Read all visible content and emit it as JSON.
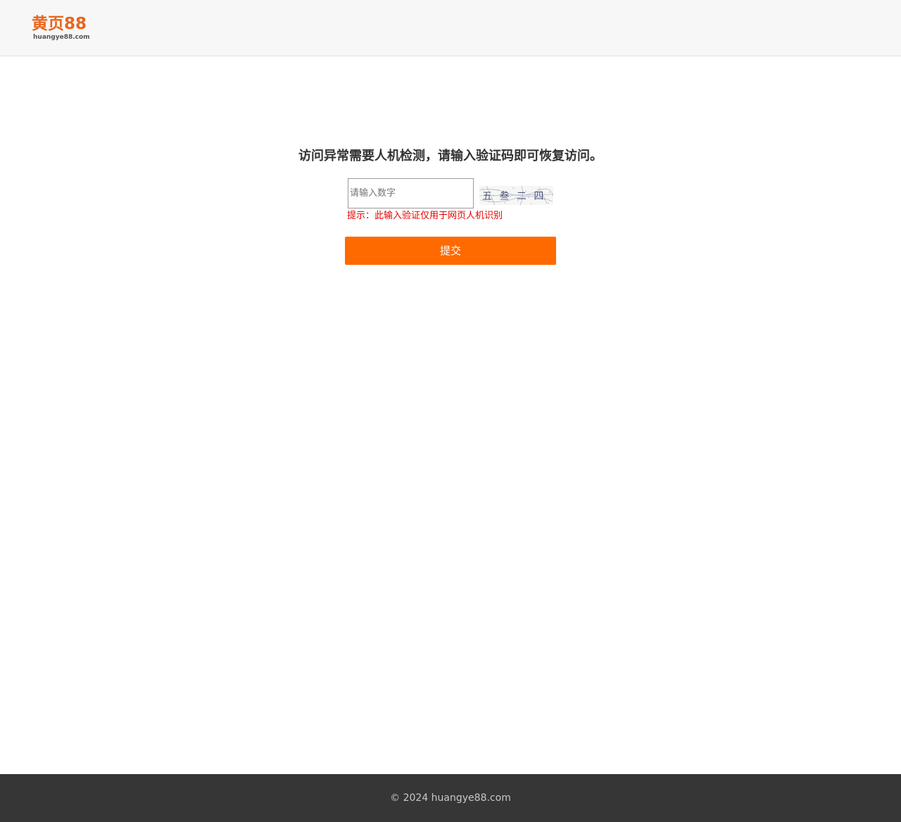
{
  "header": {
    "logo_text": "黄页88",
    "logo_subtext": "huangye88.com"
  },
  "main": {
    "title": "访问异常需要人机检测，请输入验证码即可恢复访问。",
    "input_placeholder": "请输入数字",
    "input_value": "",
    "captcha_text": "五 叁 二 四",
    "hint": "提示：此输入验证仅用于网页人机识别",
    "submit_label": "提交"
  },
  "footer": {
    "copyright": "© 2024 huangye88.com"
  },
  "colors": {
    "accent": "#ff6a00",
    "logo": "#e8661d",
    "hint": "#e60000",
    "footer_bg": "#363636"
  }
}
